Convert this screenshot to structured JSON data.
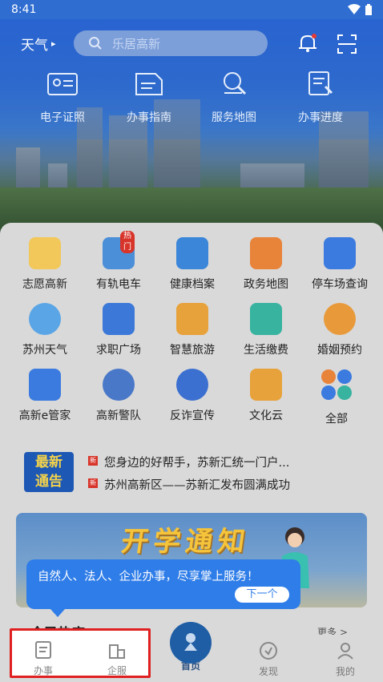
{
  "status": {
    "time": "8:41"
  },
  "header": {
    "weather_label": "天气",
    "weather_arrow": "▸",
    "search_placeholder": "乐居高新",
    "icons": [
      "bell-icon",
      "scan-icon"
    ]
  },
  "quick_actions": [
    {
      "label": "电子证照",
      "icon": "id-card-icon"
    },
    {
      "label": "办事指南",
      "icon": "guide-icon"
    },
    {
      "label": "服务地图",
      "icon": "map-search-icon"
    },
    {
      "label": "办事进度",
      "icon": "progress-icon"
    }
  ],
  "services": [
    {
      "label": "志愿高新",
      "icon": "volunteer-icon",
      "color": "#e6a13a"
    },
    {
      "label": "有轨电车",
      "icon": "tram-icon",
      "color": "#4a8fd8",
      "badge": "热门"
    },
    {
      "label": "健康档案",
      "icon": "health-record-icon",
      "color": "#3b86d9"
    },
    {
      "label": "政务地图",
      "icon": "gov-map-icon",
      "color": "#e8833a"
    },
    {
      "label": "停车场查询",
      "icon": "parking-icon",
      "color": "#3b7be0"
    },
    {
      "label": "苏州天气",
      "icon": "weather-icon",
      "color": "#5aa5e6"
    },
    {
      "label": "求职广场",
      "icon": "job-icon",
      "color": "#3c78d8"
    },
    {
      "label": "智慧旅游",
      "icon": "cable-car-icon",
      "color": "#e8a23b"
    },
    {
      "label": "生活缴费",
      "icon": "payment-icon",
      "color": "#37b3a0"
    },
    {
      "label": "婚姻预约",
      "icon": "marriage-icon",
      "color": "#e89a3a"
    },
    {
      "label": "高新e管家",
      "icon": "butler-icon",
      "color": "#3b7be0"
    },
    {
      "label": "高新警队",
      "icon": "police-icon",
      "color": "#4a78c8"
    },
    {
      "label": "反诈宣传",
      "icon": "anti-fraud-icon",
      "color": "#3b6fd0"
    },
    {
      "label": "文化云",
      "icon": "culture-cloud-icon",
      "color": "#e8a23b"
    },
    {
      "label": "全部",
      "icon": "all-apps-icon",
      "color": "#e8833a"
    }
  ],
  "notice": {
    "logo_line1": "最新",
    "logo_line2": "通告",
    "tag": "新",
    "items": [
      "您身边的好帮手，苏新汇统一门户...",
      "苏州高新区——苏新汇发布圆满成功"
    ]
  },
  "banner": {
    "title": "开学通知"
  },
  "tooltip": {
    "text": "自然人、法人、企业办事，尽享掌上服务！",
    "next": "下一个"
  },
  "section": {
    "title": "全民热度",
    "more": "更多 >"
  },
  "tabbar": [
    {
      "label": "办事",
      "icon": "document-icon"
    },
    {
      "label": "企服",
      "icon": "building-icon"
    },
    {
      "label": "首页",
      "icon": "home-icon"
    },
    {
      "label": "发现",
      "icon": "discover-icon"
    },
    {
      "label": "我的",
      "icon": "profile-icon"
    }
  ]
}
